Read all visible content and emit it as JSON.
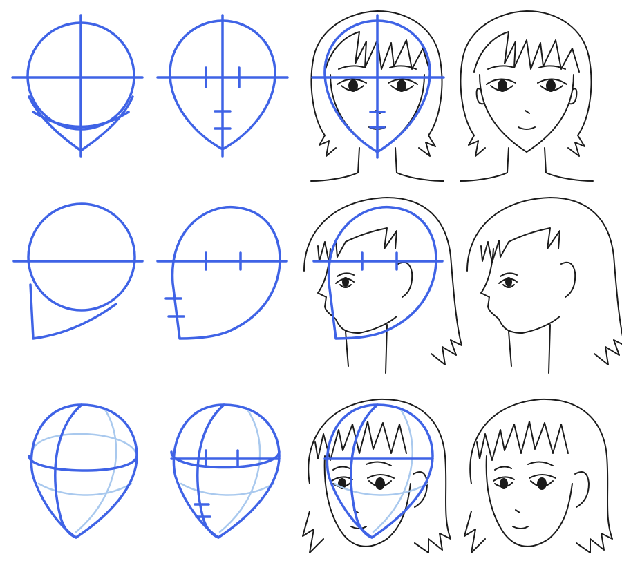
{
  "sheet": {
    "title": "",
    "colors": {
      "guide": "#3f63e6",
      "guide_light": "#a9c9ee",
      "ink": "#1b1b1b",
      "background": "#ffffff"
    },
    "rows": [
      {
        "view": "front",
        "steps": [
          "circle-with-crosshair",
          "head-shape-with-marks",
          "guidelines-over-drawing",
          "final-drawing"
        ]
      },
      {
        "view": "profile",
        "steps": [
          "circle-with-jaw",
          "head-shape-with-marks",
          "guidelines-over-drawing",
          "final-drawing"
        ]
      },
      {
        "view": "three-quarter",
        "steps": [
          "sphere-with-curves",
          "head-shape-with-marks",
          "guidelines-over-drawing",
          "final-drawing"
        ]
      }
    ]
  }
}
